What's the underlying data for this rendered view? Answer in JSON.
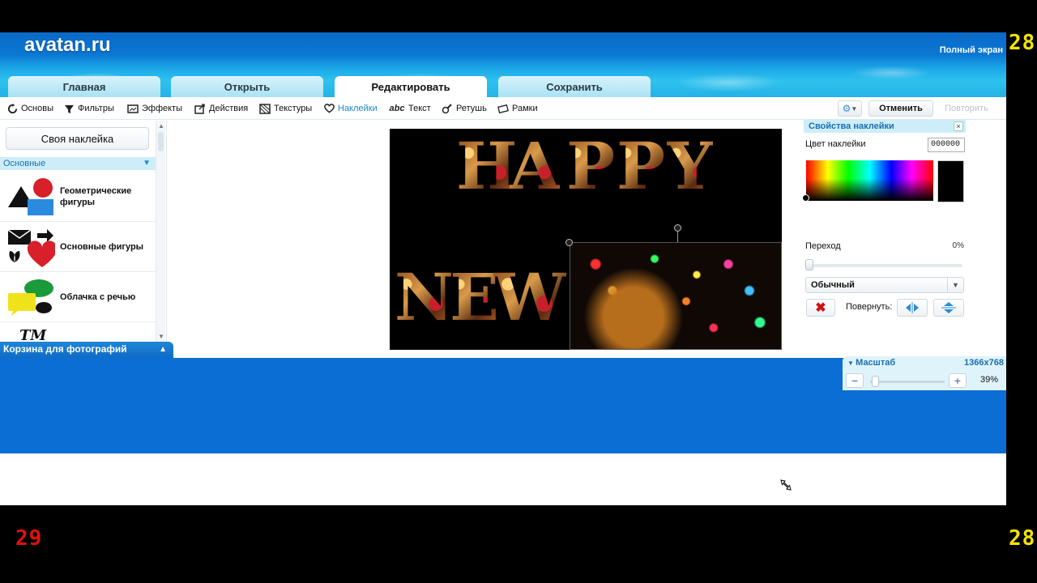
{
  "app": {
    "logo": "avatan.ru",
    "fullscreen_label": "Полный экран"
  },
  "counters": {
    "top_right": "28",
    "bottom_left": "29",
    "bottom_right": "28"
  },
  "tabs": [
    {
      "label": "Главная"
    },
    {
      "label": "Открыть"
    },
    {
      "label": "Редактировать",
      "active": true
    },
    {
      "label": "Сохранить"
    }
  ],
  "toolbar": {
    "items": [
      {
        "label": "Основы",
        "icon": "reset-icon"
      },
      {
        "label": "Фильтры",
        "icon": "filter-icon"
      },
      {
        "label": "Эффекты",
        "icon": "effects-icon"
      },
      {
        "label": "Действия",
        "icon": "actions-icon"
      },
      {
        "label": "Текстуры",
        "icon": "textures-icon"
      },
      {
        "label": "Наклейки",
        "icon": "heart-icon",
        "active": true
      },
      {
        "label": "Текст",
        "icon": "text-icon",
        "icon_text": "abc"
      },
      {
        "label": "Ретушь",
        "icon": "retouch-icon"
      },
      {
        "label": "Рамки",
        "icon": "frames-icon"
      }
    ],
    "undo_label": "Отменить",
    "redo_label": "Повторить"
  },
  "left_panel": {
    "custom_sticker_label": "Своя наклейка",
    "category_header": "Основные",
    "categories": [
      {
        "label": "Геометрические фигуры"
      },
      {
        "label": "Основные фигуры"
      },
      {
        "label": "Облачка с речью"
      },
      {
        "label": "TM"
      }
    ],
    "basket_label": "Корзина для фотографий"
  },
  "canvas": {
    "word1": [
      "H",
      "A",
      "P",
      "P",
      "Y"
    ],
    "word2": [
      "N",
      "E",
      "W"
    ]
  },
  "sticker_props": {
    "title": "Свойства наклейки",
    "color_label": "Цвет наклейки",
    "color_value": "000000",
    "transparency_label": "Переход",
    "transparency_value": "0%",
    "transparency_fraction": 0,
    "blend_mode": "Обычный",
    "rotate_label": "Повернуть:"
  },
  "zoom": {
    "label": "Масштаб",
    "resolution": "1366x768",
    "percent": "39%",
    "minus": "−",
    "plus": "+"
  },
  "colors": {
    "accent_blue": "#0b6ed4",
    "active_tab_text": "#111111",
    "delete_red": "#d01010"
  }
}
